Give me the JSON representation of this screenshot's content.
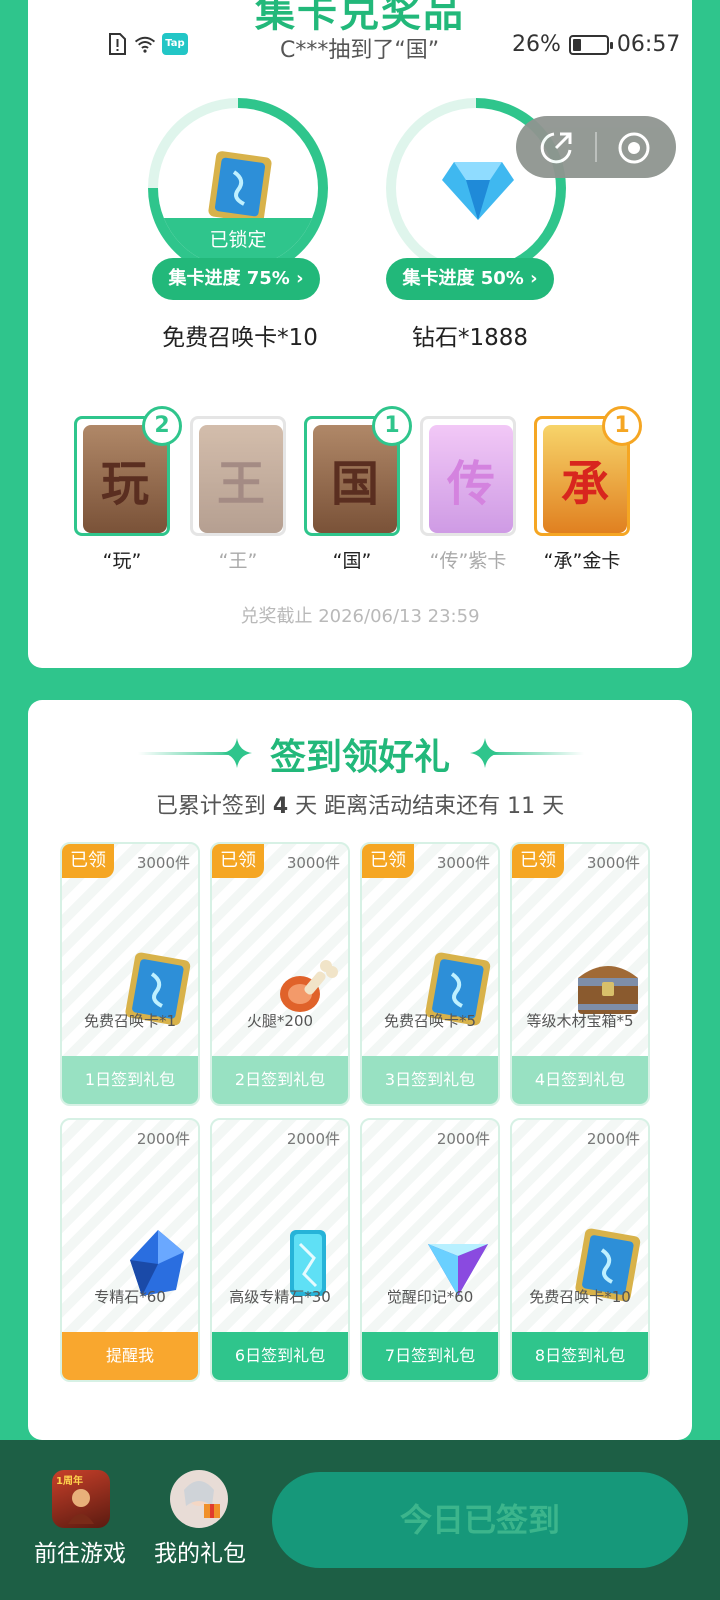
{
  "top_title": "集卡兑奖品",
  "status_bar": {
    "tap_label": "Tap",
    "broadcast": "C***抽到了“国”",
    "battery": "26%",
    "battery_level": 0.26,
    "time": "06:57"
  },
  "prizes": [
    {
      "locked_label": "已锁定",
      "progress_label": "集卡进度 75%",
      "progress": 0.75,
      "name": "免费召唤卡*10"
    },
    {
      "progress_label": "集卡进度 50%",
      "progress": 0.5,
      "name": "钻石*1888"
    }
  ],
  "word_cards": [
    {
      "char": "玩",
      "label": "“玩”",
      "count": "2",
      "owned": true
    },
    {
      "char": "王",
      "label": "“王”",
      "count": "",
      "owned": false
    },
    {
      "char": "国",
      "label": "“国”",
      "count": "1",
      "owned": true
    },
    {
      "char": "传",
      "label": "“传”紫卡",
      "count": "",
      "owned": false
    },
    {
      "char": "承",
      "label": "“承”金卡",
      "count": "1",
      "owned": true
    }
  ],
  "deadline": "兑奖截止 2026/06/13 23:59",
  "checkin": {
    "title": "签到领好礼",
    "subtitle_prefix": "已累计签到",
    "days_signed": "4",
    "subtitle_mid": "天  距离活动结束还有 11 天",
    "tiles": [
      {
        "claimed": "已领",
        "qty": "3000件",
        "reward": "免费召唤卡*1",
        "button": "1日签到礼包",
        "icon": "summon-card-icon"
      },
      {
        "claimed": "已领",
        "qty": "3000件",
        "reward": "火腿*200",
        "button": "2日签到礼包",
        "icon": "ham-icon"
      },
      {
        "claimed": "已领",
        "qty": "3000件",
        "reward": "免费召唤卡*5",
        "button": "3日签到礼包",
        "icon": "summon-card-icon"
      },
      {
        "claimed": "已领",
        "qty": "3000件",
        "reward": "等级木材宝箱*5",
        "button": "4日签到礼包",
        "icon": "treasure-chest-icon"
      },
      {
        "qty": "2000件",
        "reward": "专精石*60",
        "button": "提醒我",
        "icon": "mastery-stone-icon"
      },
      {
        "qty": "2000件",
        "reward": "高级专精石*30",
        "button": "6日签到礼包",
        "icon": "advanced-mastery-stone-icon"
      },
      {
        "qty": "2000件",
        "reward": "觉醒印记*60",
        "button": "7日签到礼包",
        "icon": "awakening-mark-icon"
      },
      {
        "qty": "2000件",
        "reward": "免费召唤卡*10",
        "button": "8日签到礼包",
        "icon": "summon-card-icon"
      }
    ]
  },
  "bottom_bar": {
    "go_game": "前往游戏",
    "my_gifts": "我的礼包",
    "signed_today": "今日已签到",
    "game_badge": "1周年"
  },
  "colors": {
    "brand_green": "#2fc58c",
    "dark_green": "#1d5f45",
    "orange": "#f5a623"
  }
}
